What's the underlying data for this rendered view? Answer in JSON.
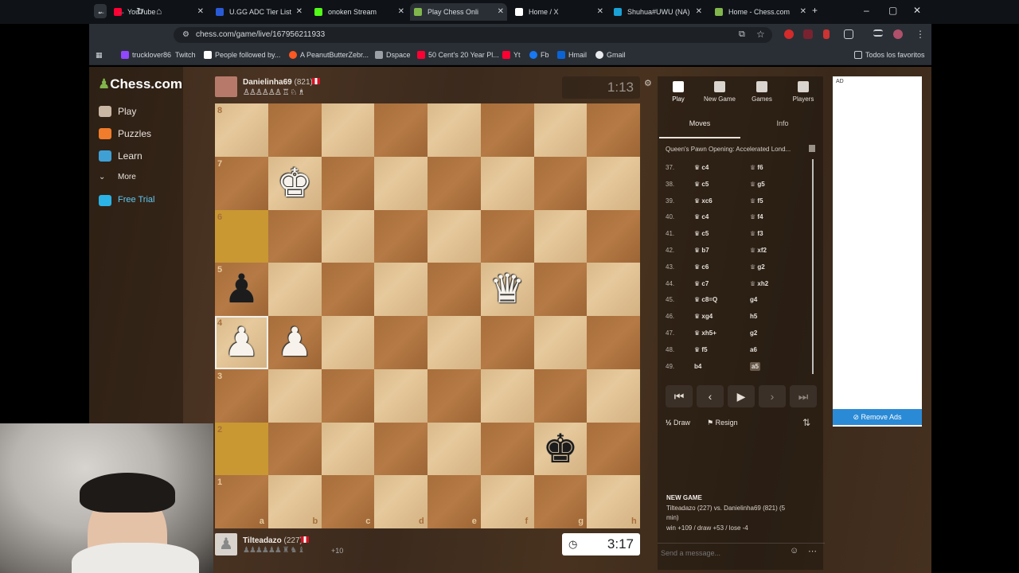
{
  "tabs": [
    {
      "label": "YouTube",
      "color": "#ff0033"
    },
    {
      "label": "U.GG ADC Tier List",
      "color": "#2a5bd7"
    },
    {
      "label": "onoken Stream",
      "color": "#53fc18"
    },
    {
      "label": "Play Chess Onli",
      "color": "#81b64c"
    },
    {
      "label": "Home / X",
      "color": "#ffffff"
    },
    {
      "label": "Shuhua#UWU (NA)",
      "color": "#1aa1d6"
    },
    {
      "label": "Home - Chess.com",
      "color": "#81b64c"
    }
  ],
  "url": "chess.com/game/live/167956211933",
  "bookmarks": [
    "trucklover86",
    "Twitch",
    "People followed by...",
    "A PeanutButterZebr...",
    "Dspace",
    "50 Cent's 20 Year Pl...",
    "Yt",
    "Fb",
    "Hmail",
    "Gmail"
  ],
  "bookmarks_right": "Todos los favoritos",
  "nav": {
    "logo": "Chess.com",
    "play": "Play",
    "puzzles": "Puzzles",
    "learn": "Learn",
    "more": "More",
    "free_trial": "Free Trial"
  },
  "top_player": {
    "name": "Danielinha69",
    "rating": "(821)",
    "clock": "1:13"
  },
  "bottom_player": {
    "name": "Tilteadazo",
    "rating": "(227)",
    "clock": "3:17",
    "material": "+10"
  },
  "files": [
    "a",
    "b",
    "c",
    "d",
    "e",
    "f",
    "g",
    "h"
  ],
  "ranks": [
    "8",
    "7",
    "6",
    "5",
    "4",
    "3",
    "2",
    "1"
  ],
  "panel": {
    "tabs": [
      "Play",
      "New Game",
      "Games",
      "Players"
    ],
    "subtabs": [
      "Moves",
      "Info"
    ],
    "opening": "Queen's Pawn Opening: Accelerated Lond...",
    "moves": [
      {
        "n": "37.",
        "w": "c4",
        "b": "f6"
      },
      {
        "n": "38.",
        "w": "c5",
        "b": "g5"
      },
      {
        "n": "39.",
        "w": "xc6",
        "b": "f5"
      },
      {
        "n": "40.",
        "w": "c4",
        "b": "f4"
      },
      {
        "n": "41.",
        "w": "c5",
        "b": "f3"
      },
      {
        "n": "42.",
        "w": "b7",
        "b": "xf2"
      },
      {
        "n": "43.",
        "w": "c6",
        "b": "g2"
      },
      {
        "n": "44.",
        "w": "c7",
        "b": "xh2"
      },
      {
        "n": "45.",
        "w": "c8=Q",
        "b": "g4"
      },
      {
        "n": "46.",
        "w": "xg4",
        "b": "h5"
      },
      {
        "n": "47.",
        "w": "xh5+",
        "b": "g2"
      },
      {
        "n": "48.",
        "w": "f5",
        "b": "a6"
      },
      {
        "n": "49.",
        "w": "b4",
        "b": "a5"
      }
    ],
    "draw": "Draw",
    "resign": "Resign",
    "new_game_title": "NEW GAME",
    "new_game_line1": "Tilteadazo (227) vs. Danielinha69 (821) (5",
    "new_game_line2": "min)",
    "new_game_line3": "win +109 / draw +53 / lose -4",
    "message_placeholder": "Send a message..."
  },
  "ad": {
    "label": "AD",
    "remove": "Remove Ads"
  }
}
